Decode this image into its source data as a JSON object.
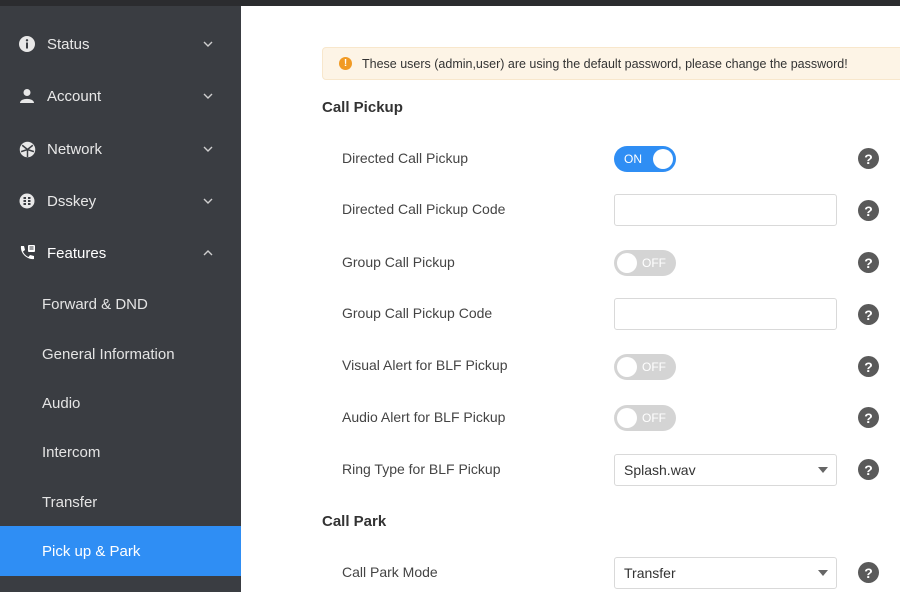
{
  "sidebar": {
    "items": [
      {
        "label": "Status",
        "icon": "info-icon"
      },
      {
        "label": "Account",
        "icon": "user-icon"
      },
      {
        "label": "Network",
        "icon": "network-icon"
      },
      {
        "label": "Dsskey",
        "icon": "dsskey-icon"
      },
      {
        "label": "Features",
        "icon": "phone-features-icon"
      }
    ],
    "features_sub": [
      {
        "label": "Forward & DND"
      },
      {
        "label": "General Information"
      },
      {
        "label": "Audio"
      },
      {
        "label": "Intercom"
      },
      {
        "label": "Transfer"
      },
      {
        "label": "Pick up & Park"
      }
    ],
    "selected": "Pick up & Park"
  },
  "alert": {
    "text": "These users (admin,user) are using the default password, please change the password!"
  },
  "call_pickup": {
    "title": "Call Pickup",
    "directed": {
      "label": "Directed Call Pickup",
      "state": "ON"
    },
    "directed_code": {
      "label": "Directed Call Pickup Code",
      "value": ""
    },
    "group": {
      "label": "Group Call Pickup",
      "state": "OFF"
    },
    "group_code": {
      "label": "Group Call Pickup Code",
      "value": ""
    },
    "visual_alert": {
      "label": "Visual Alert for BLF Pickup",
      "state": "OFF"
    },
    "audio_alert": {
      "label": "Audio Alert for BLF Pickup",
      "state": "OFF"
    },
    "ring_type": {
      "label": "Ring Type for BLF Pickup",
      "value": "Splash.wav"
    }
  },
  "call_park": {
    "title": "Call Park",
    "mode": {
      "label": "Call Park Mode",
      "value": "Transfer"
    }
  },
  "help_symbol": "?",
  "colors": {
    "sidebar_bg": "#3a3d42",
    "accent": "#2f8ef4",
    "alert_bg": "#fdf4e6",
    "alert_icon": "#f19a24"
  }
}
